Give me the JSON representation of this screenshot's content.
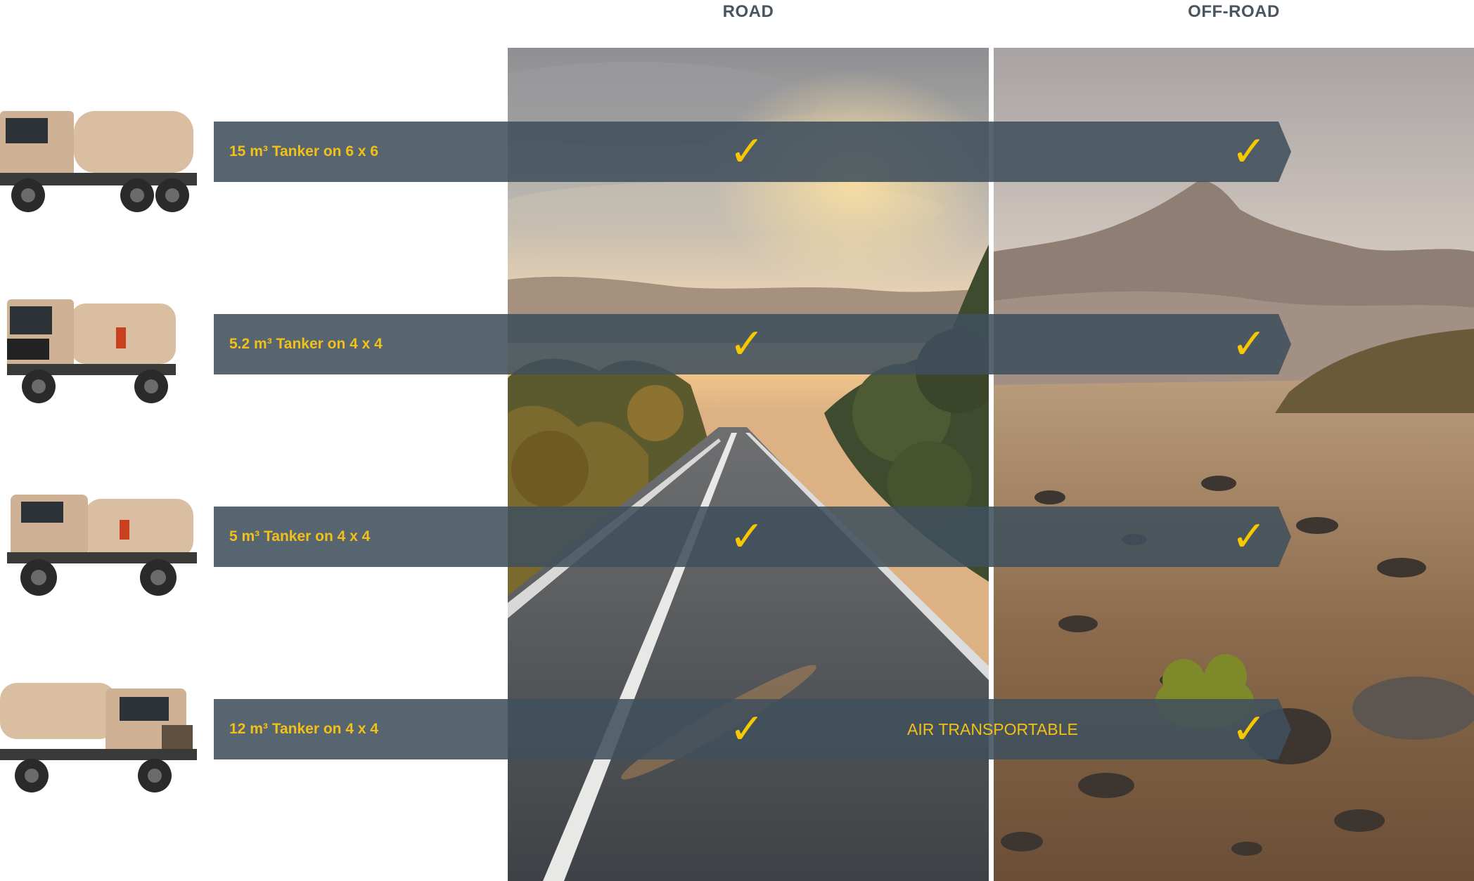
{
  "columns": {
    "road": "ROAD",
    "offroad": "OFF-ROAD"
  },
  "rows": [
    {
      "label": "15 m³ Tanker on 6 x 6",
      "road_check": "✓",
      "offroad_check": "✓",
      "note": ""
    },
    {
      "label": "5.2 m³ Tanker on 4 x 4",
      "road_check": "✓",
      "offroad_check": "✓",
      "note": ""
    },
    {
      "label": "5 m³ Tanker on 4 x 4",
      "road_check": "✓",
      "offroad_check": "✓",
      "note": ""
    },
    {
      "label": "12 m³ Tanker on 4 x 4",
      "road_check": "✓",
      "offroad_check": "✓",
      "note": "AIR TRANSPORTABLE"
    }
  ],
  "colors": {
    "banner": "#40505c",
    "accent": "#f2c018",
    "header_text": "#4a5560"
  }
}
